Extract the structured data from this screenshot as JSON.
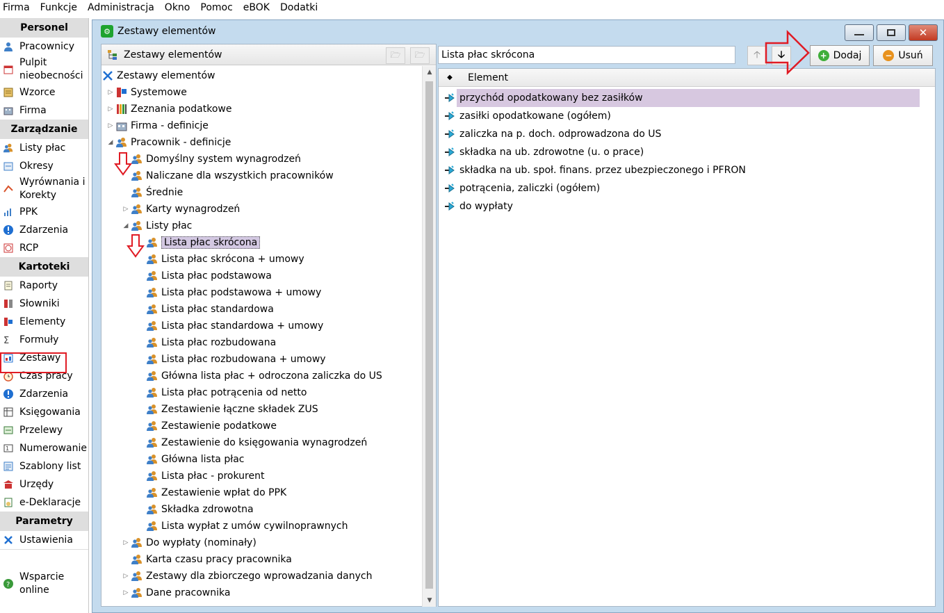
{
  "menubar": {
    "items": [
      "Firma",
      "Funkcje",
      "Administracja",
      "Okno",
      "Pomoc",
      "eBOK",
      "Dodatki"
    ]
  },
  "nav": {
    "sections": [
      {
        "header": "Personel",
        "items": [
          {
            "label": "Pracownicy",
            "icon": "person-icon"
          },
          {
            "label": "Pulpit nieobecności",
            "icon": "calendar-icon"
          },
          {
            "label": "Wzorce",
            "icon": "template-icon"
          },
          {
            "label": "Firma",
            "icon": "building-icon"
          }
        ]
      },
      {
        "header": "Zarządzanie",
        "items": [
          {
            "label": "Listy płac",
            "icon": "people-icon"
          },
          {
            "label": "Okresy",
            "icon": "period-icon"
          },
          {
            "label": "Wyrównania i Korekty",
            "icon": "correction-icon"
          },
          {
            "label": "PPK",
            "icon": "chart-icon"
          },
          {
            "label": "Zdarzenia",
            "icon": "event-icon"
          },
          {
            "label": "RCP",
            "icon": "clock-icon"
          }
        ]
      },
      {
        "header": "Kartoteki",
        "items": [
          {
            "label": "Raporty",
            "icon": "report-icon"
          },
          {
            "label": "Słowniki",
            "icon": "dictionary-icon"
          },
          {
            "label": "Elementy",
            "icon": "elements-icon"
          },
          {
            "label": "Formuły",
            "icon": "sigma-icon"
          },
          {
            "label": "Zestawy",
            "icon": "sets-icon"
          },
          {
            "label": "Czas pracy",
            "icon": "alarm-icon"
          },
          {
            "label": "Zdarzenia",
            "icon": "event-icon"
          },
          {
            "label": "Księgowania",
            "icon": "ledger-icon"
          },
          {
            "label": "Przelewy",
            "icon": "transfer-icon"
          },
          {
            "label": "Numerowanie",
            "icon": "numbering-icon"
          },
          {
            "label": "Szablony list",
            "icon": "list-template-icon"
          },
          {
            "label": "Urzędy",
            "icon": "office-icon"
          },
          {
            "label": "e-Deklaracje",
            "icon": "edeclaration-icon"
          }
        ]
      },
      {
        "header": "Parametry",
        "items": [
          {
            "label": "Ustawienia",
            "icon": "tools-icon"
          }
        ]
      }
    ],
    "support": {
      "label": "Wsparcie online",
      "icon": "support-icon"
    }
  },
  "window": {
    "title": "Zestawy elementów"
  },
  "leftpane": {
    "header": "Zestawy elementów",
    "tree": {
      "root": "Zestawy elementów",
      "nodes": [
        {
          "label": "Systemowe",
          "level": 1,
          "expander": "collapsed",
          "icon": "system-icon"
        },
        {
          "label": "Zeznania podatkowe",
          "level": 1,
          "expander": "collapsed",
          "icon": "books-icon"
        },
        {
          "label": "Firma - definicje",
          "level": 1,
          "expander": "collapsed",
          "icon": "building-icon"
        },
        {
          "label": "Pracownik - definicje",
          "level": 1,
          "expander": "expanded",
          "icon": "people-icon"
        },
        {
          "label": "Domyślny system wynagrodzeń",
          "level": 2,
          "expander": "none",
          "icon": "people-icon"
        },
        {
          "label": "Naliczane dla wszystkich pracowników",
          "level": 2,
          "expander": "none",
          "icon": "people-icon"
        },
        {
          "label": "Średnie",
          "level": 2,
          "expander": "none",
          "icon": "people-icon"
        },
        {
          "label": "Karty wynagrodzeń",
          "level": 2,
          "expander": "collapsed",
          "icon": "people-icon"
        },
        {
          "label": "Listy płac",
          "level": 2,
          "expander": "expanded",
          "icon": "people-icon"
        },
        {
          "label": "Lista płac skrócona",
          "level": 3,
          "expander": "none",
          "icon": "people-icon",
          "selected": true
        },
        {
          "label": "Lista płac skrócona + umowy",
          "level": 3,
          "expander": "none",
          "icon": "people-icon"
        },
        {
          "label": "Lista płac podstawowa",
          "level": 3,
          "expander": "none",
          "icon": "people-icon"
        },
        {
          "label": "Lista płac podstawowa + umowy",
          "level": 3,
          "expander": "none",
          "icon": "people-icon"
        },
        {
          "label": "Lista płac standardowa",
          "level": 3,
          "expander": "none",
          "icon": "people-icon"
        },
        {
          "label": "Lista płac standardowa + umowy",
          "level": 3,
          "expander": "none",
          "icon": "people-icon"
        },
        {
          "label": "Lista płac rozbudowana",
          "level": 3,
          "expander": "none",
          "icon": "people-icon"
        },
        {
          "label": "Lista płac rozbudowana + umowy",
          "level": 3,
          "expander": "none",
          "icon": "people-icon"
        },
        {
          "label": "Główna lista płac + odroczona zaliczka do US",
          "level": 3,
          "expander": "none",
          "icon": "people-icon"
        },
        {
          "label": "Lista płac potrącenia od netto",
          "level": 3,
          "expander": "none",
          "icon": "people-icon"
        },
        {
          "label": "Zestawienie łączne składek ZUS",
          "level": 3,
          "expander": "none",
          "icon": "people-icon"
        },
        {
          "label": "Zestawienie podatkowe",
          "level": 3,
          "expander": "none",
          "icon": "people-icon"
        },
        {
          "label": "Zestawienie do księgowania wynagrodzeń",
          "level": 3,
          "expander": "none",
          "icon": "people-icon"
        },
        {
          "label": "Główna lista płac",
          "level": 3,
          "expander": "none",
          "icon": "people-icon"
        },
        {
          "label": "Lista płac - prokurent",
          "level": 3,
          "expander": "none",
          "icon": "people-icon"
        },
        {
          "label": "Zestawienie wpłat do PPK",
          "level": 3,
          "expander": "none",
          "icon": "people-icon"
        },
        {
          "label": "Składka zdrowotna",
          "level": 3,
          "expander": "none",
          "icon": "people-icon"
        },
        {
          "label": "Lista wypłat z umów cywilnoprawnych",
          "level": 3,
          "expander": "none",
          "icon": "people-icon"
        },
        {
          "label": "Do wypłaty (nominały)",
          "level": 2,
          "expander": "collapsed",
          "icon": "people-icon"
        },
        {
          "label": "Karta czasu pracy pracownika",
          "level": 2,
          "expander": "none",
          "icon": "people-icon"
        },
        {
          "label": "Zestawy dla zbiorczego wprowadzania danych",
          "level": 2,
          "expander": "collapsed",
          "icon": "people-icon"
        },
        {
          "label": "Dane pracownika",
          "level": 2,
          "expander": "collapsed",
          "icon": "people-icon"
        }
      ]
    }
  },
  "rightpane": {
    "name_value": "Lista płac skrócona",
    "buttons": {
      "add": "Dodaj",
      "remove": "Usuń"
    },
    "grid": {
      "column": "Element",
      "rows": [
        {
          "label": "przychód opodatkowany bez zasiłków",
          "selected": true
        },
        {
          "label": "zasiłki opodatkowane (ogółem)"
        },
        {
          "label": "zaliczka na p. doch. odprowadzona do US"
        },
        {
          "label": "składka na ub. zdrowotne (u. o prace)"
        },
        {
          "label": "składka na ub. społ. finans. przez ubezpieczonego i PFRON"
        },
        {
          "label": "potrącenia, zaliczki (ogółem)"
        },
        {
          "label": "do wypłaty"
        }
      ]
    }
  },
  "colors": {
    "accent": "#e01b24",
    "selection": "#d3c8e2",
    "frame": "#c4dbee"
  }
}
